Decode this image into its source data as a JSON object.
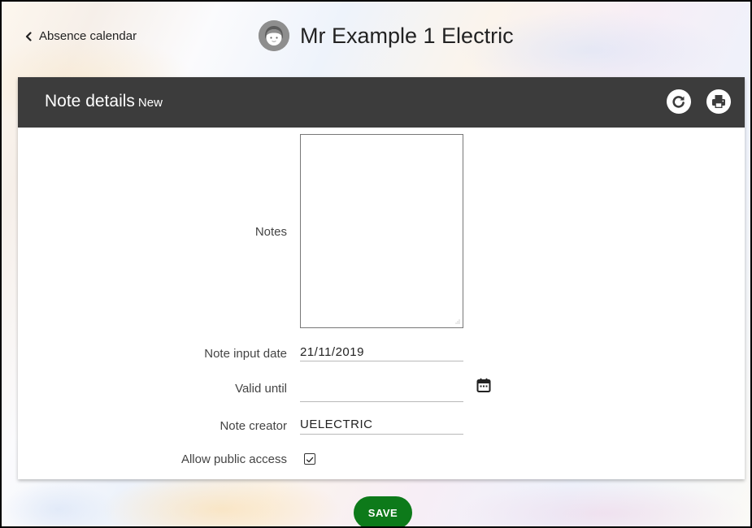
{
  "header": {
    "back_label": "Absence calendar",
    "person_name": "Mr Example 1 Electric"
  },
  "card": {
    "title": "Note details",
    "subtitle": "New"
  },
  "form": {
    "notes_label": "Notes",
    "notes_value": "",
    "input_date_label": "Note input date",
    "input_date_value": "21/11/2019",
    "valid_until_label": "Valid until",
    "valid_until_value": "",
    "creator_label": "Note creator",
    "creator_value": "UELECTRIC",
    "public_access_label": "Allow public access",
    "public_access_checked": true
  },
  "actions": {
    "save_label": "SAVE"
  },
  "icons": {
    "back": "chevron-left-icon",
    "avatar": "person-avatar-icon",
    "refresh": "refresh-icon",
    "print": "print-icon",
    "calendar": "calendar-icon",
    "checkbox": "checkbox-checked-icon"
  },
  "colors": {
    "header_bg": "#3c3c3c",
    "save_bg": "#0d7a1a"
  }
}
